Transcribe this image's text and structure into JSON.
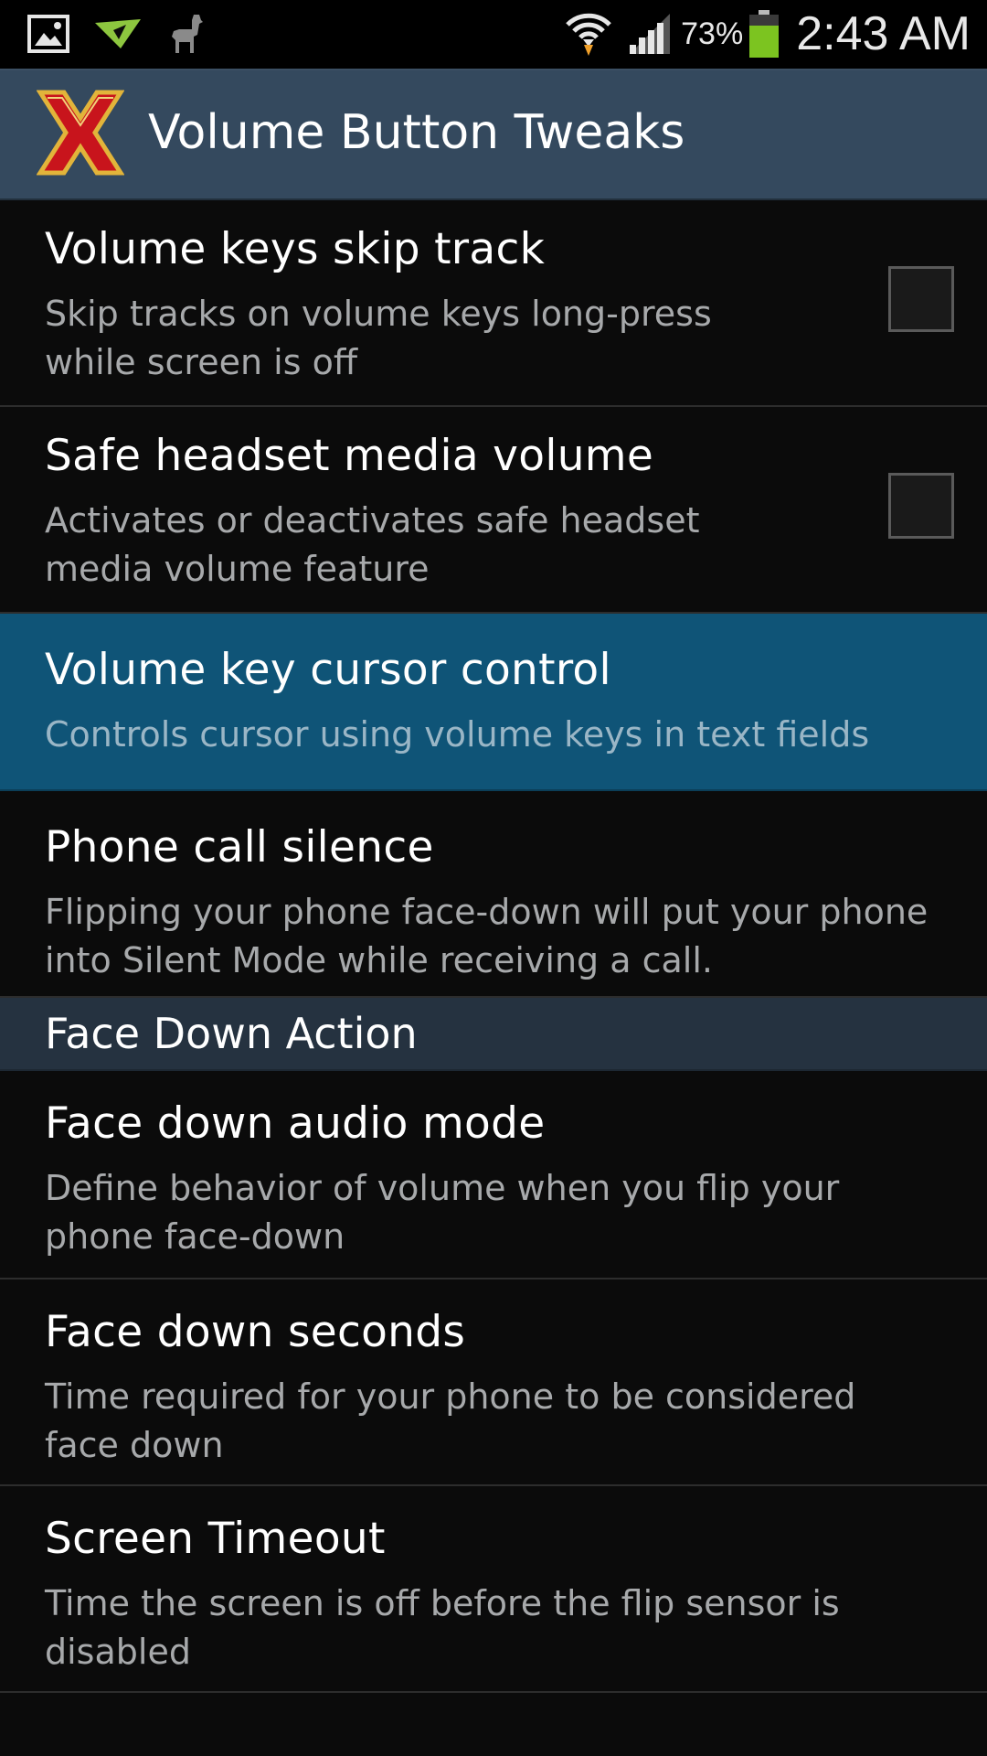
{
  "status_bar": {
    "battery_percent": "73%",
    "time": "2:43 AM",
    "left_icons": [
      "gallery-icon",
      "airdroid-icon",
      "llama-icon"
    ],
    "right_icons": [
      "wifi-icon",
      "signal-icon",
      "battery-icon"
    ],
    "battery_color": "#7cc420"
  },
  "action_bar": {
    "title": "Volume Button Tweaks",
    "logo_icon": "xposed-logo-icon",
    "background_color": "#34495e"
  },
  "preferences": [
    {
      "title": "Volume keys skip track",
      "summary": "Skip tracks on volume keys long-press while screen is off",
      "has_checkbox": true,
      "checked": false
    },
    {
      "title": "Safe headset media volume",
      "summary": "Activates or deactivates safe headset media volume feature",
      "has_checkbox": true,
      "checked": false
    },
    {
      "title": "Volume key cursor control",
      "summary": "Controls cursor using volume keys in text fields",
      "highlighted": true
    },
    {
      "title": "Phone call silence",
      "summary": "Flipping your phone face-down will put your phone into Silent Mode while receiving a call."
    }
  ],
  "section": {
    "title": "Face Down Action"
  },
  "face_down_preferences": [
    {
      "title": "Face down audio mode",
      "summary": "Define behavior of volume when you flip your phone face-down"
    },
    {
      "title": "Face down seconds",
      "summary": "Time required for your phone to be considered face down"
    },
    {
      "title": "Screen Timeout",
      "summary": "Time the screen is off before the flip sensor is disabled"
    }
  ],
  "colors": {
    "highlight": "#0f5477",
    "section_header": "#253240",
    "summary_text": "#a7a9ab"
  }
}
